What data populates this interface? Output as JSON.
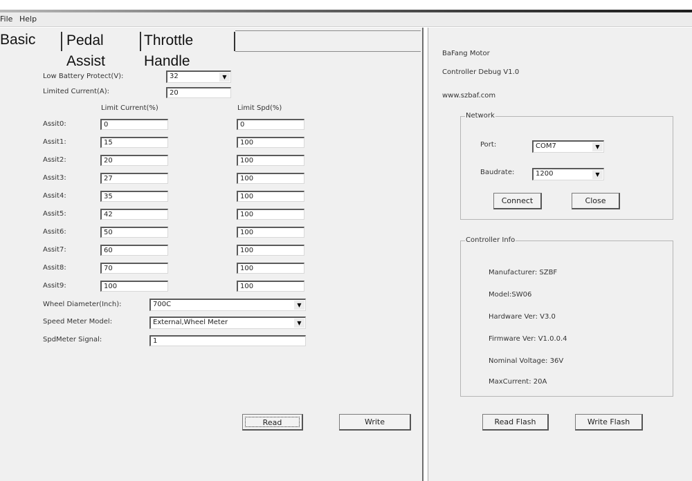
{
  "menu": {
    "file": "File",
    "help": "Help"
  },
  "tabs": [
    "Basic",
    "Pedal Assist",
    "Throttle Handle"
  ],
  "basic": {
    "low_battery_label": "Low Battery Protect(V):",
    "low_battery_value": "32",
    "limited_current_label": "Limited Current(A):",
    "limited_current_value": "20",
    "col_limit_current": "Limit Current(%)",
    "col_limit_spd": "Limit Spd(%)",
    "assists": [
      {
        "label": "Assit0:",
        "current": "0",
        "spd": "0"
      },
      {
        "label": "Assit1:",
        "current": "15",
        "spd": "100"
      },
      {
        "label": "Assit2:",
        "current": "20",
        "spd": "100"
      },
      {
        "label": "Assit3:",
        "current": "27",
        "spd": "100"
      },
      {
        "label": "Assit4:",
        "current": "35",
        "spd": "100"
      },
      {
        "label": "Assit5:",
        "current": "42",
        "spd": "100"
      },
      {
        "label": "Assit6:",
        "current": "50",
        "spd": "100"
      },
      {
        "label": "Assit7:",
        "current": "60",
        "spd": "100"
      },
      {
        "label": "Assit8:",
        "current": "70",
        "spd": "100"
      },
      {
        "label": "Assit9:",
        "current": "100",
        "spd": "100"
      }
    ],
    "wheel_label": "Wheel Diameter(Inch):",
    "wheel_value": "700C",
    "speed_meter_label": "Speed Meter Model:",
    "speed_meter_value": "External,Wheel Meter",
    "spd_signal_label": "SpdMeter Signal:",
    "spd_signal_value": "1",
    "read_button": "Read",
    "write_button": "Write"
  },
  "right": {
    "brand": "BaFang Motor",
    "debug": "Controller Debug V1.0",
    "website": "www.szbaf.com",
    "network_title": "Network",
    "port_label": "Port:",
    "port_value": "COM7",
    "baud_label": "Baudrate:",
    "baud_value": "1200",
    "connect_button": "Connect",
    "close_button": "Close",
    "info_title": "Controller Info",
    "manufacturer": "Manufacturer: SZBF",
    "model": "Model:SW06",
    "hardware": "Hardware Ver: V3.0",
    "firmware": "Firmware Ver: V1.0.0.4",
    "nominal_voltage": "Nominal Voltage: 36V",
    "max_current": "MaxCurrent: 20A",
    "read_flash_button": "Read Flash",
    "write_flash_button": "Write Flash"
  }
}
